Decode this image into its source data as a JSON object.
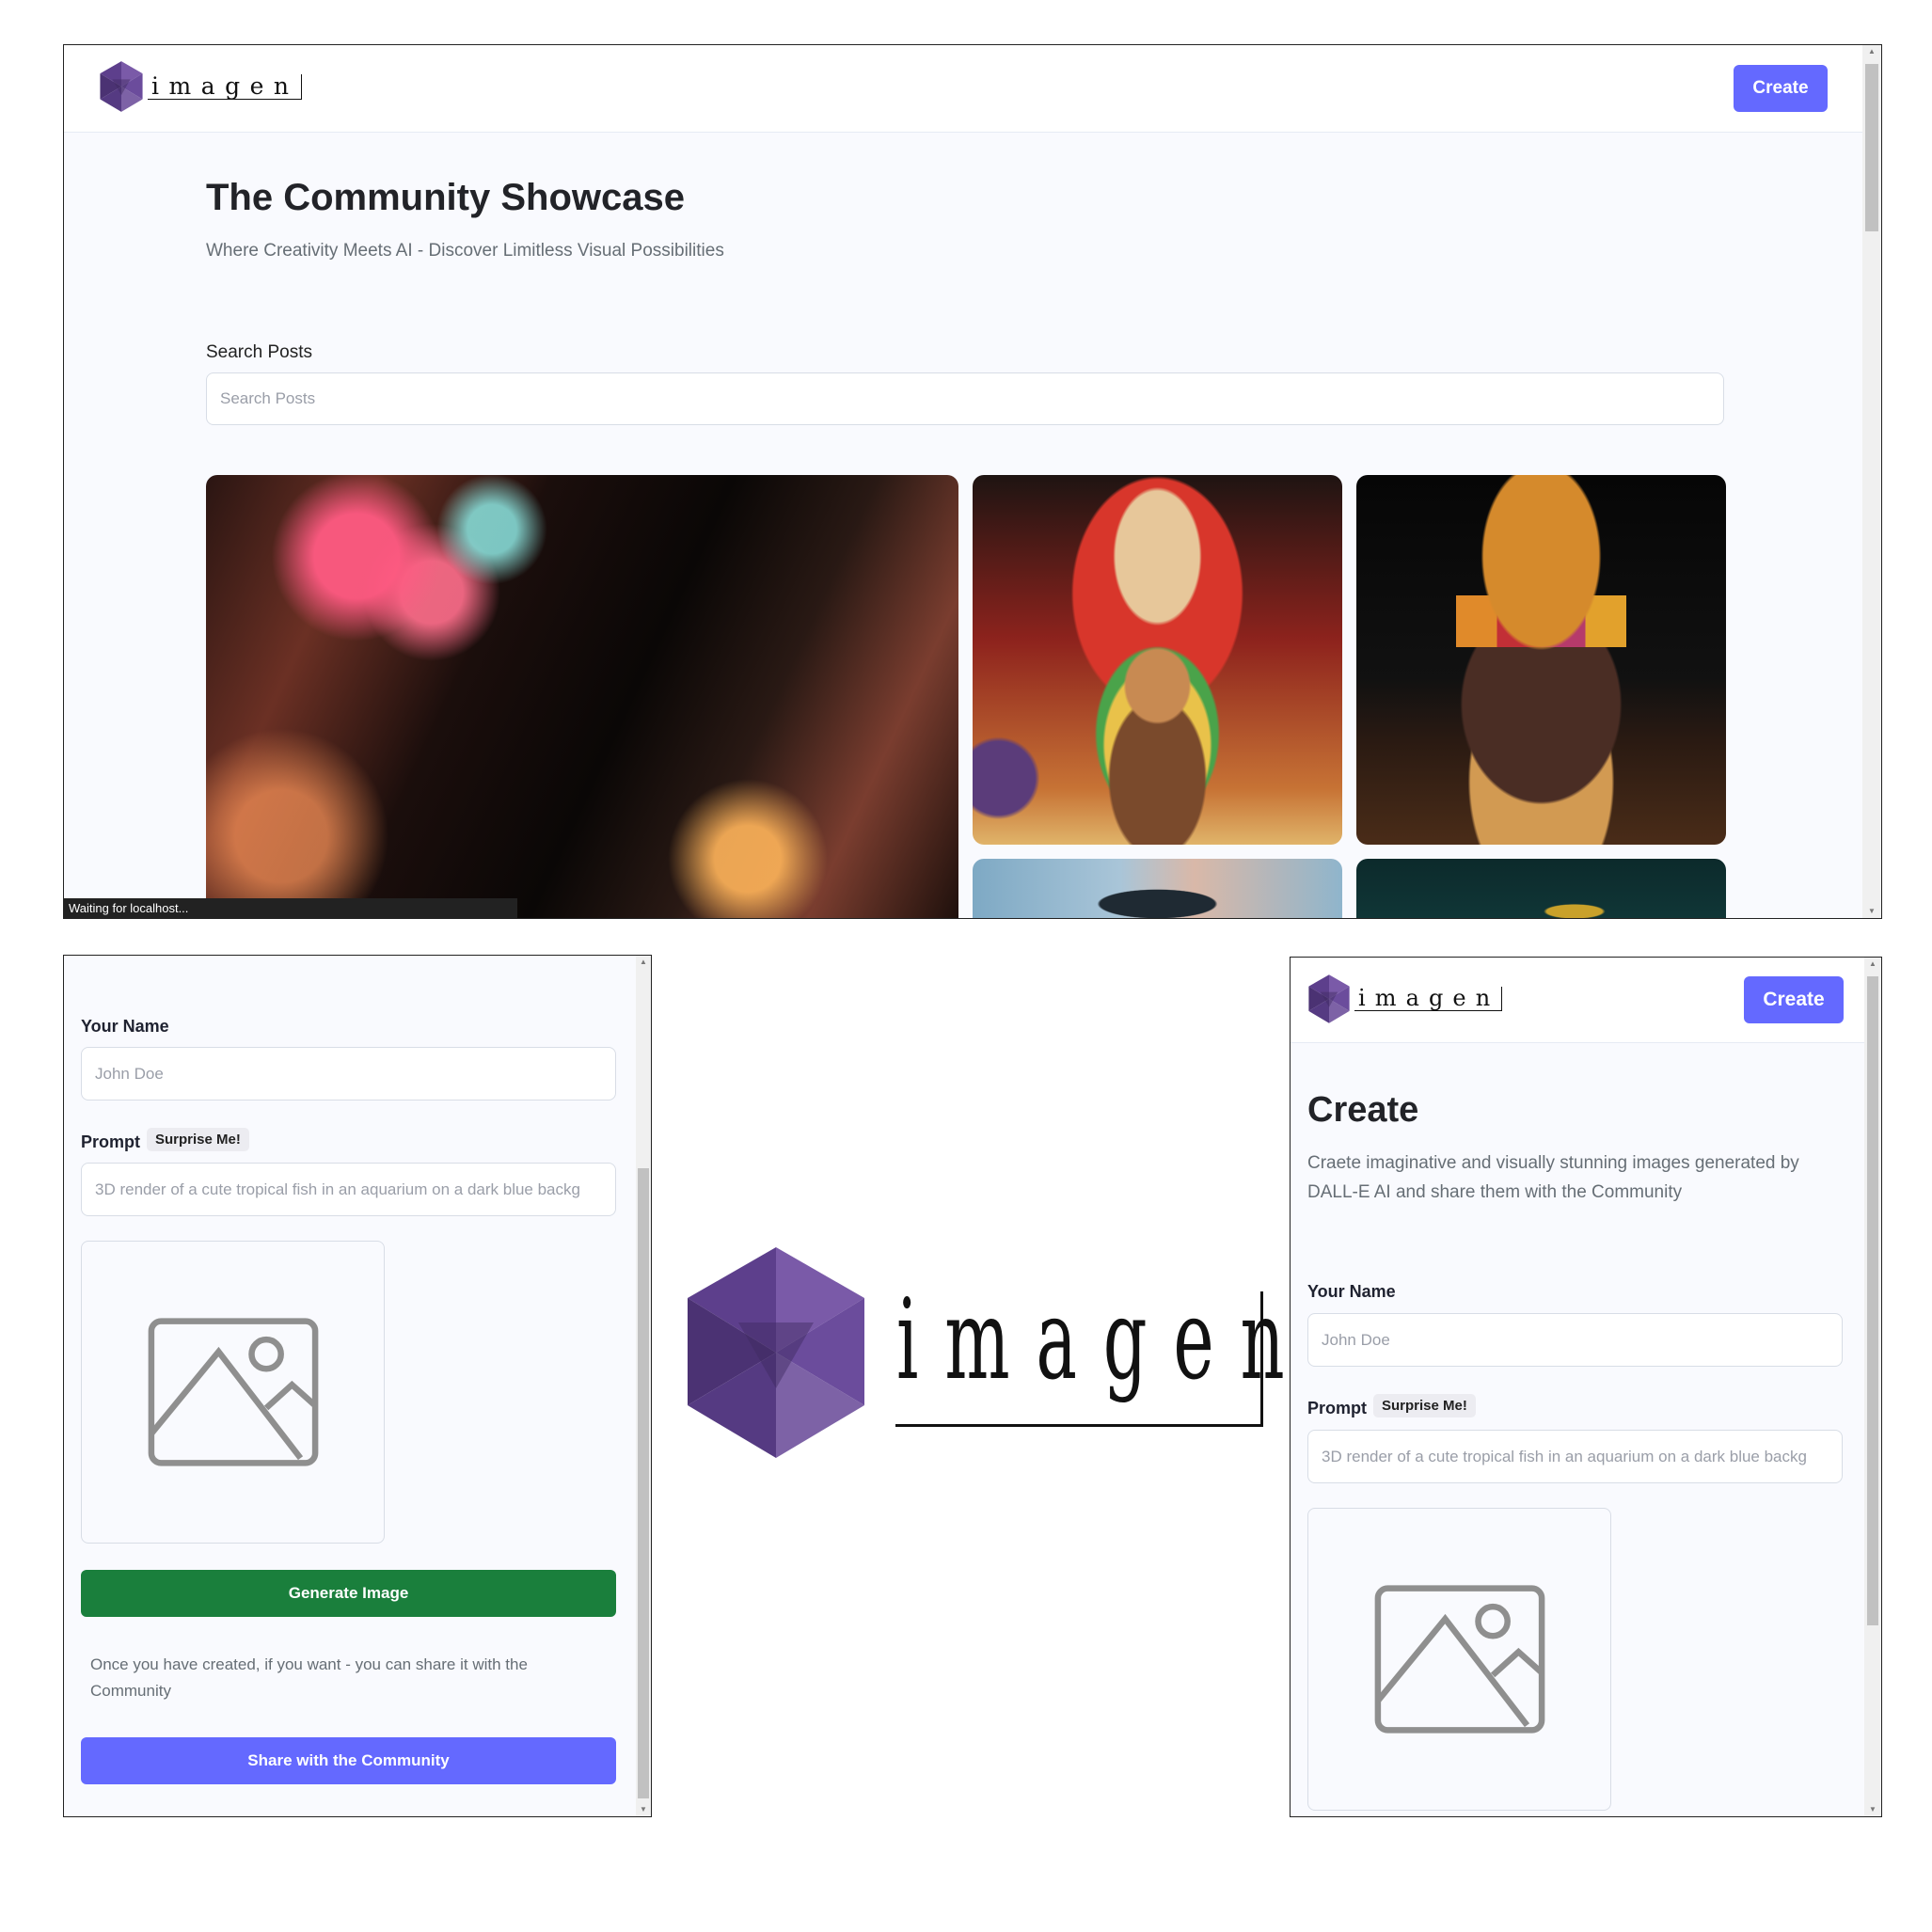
{
  "brand": {
    "logo_text": "imagen"
  },
  "home": {
    "create_button": "Create",
    "title": "The Community Showcase",
    "subtitle": "Where Creativity Meets AI - Discover Limitless Visual Possibilities",
    "search": {
      "label": "Search Posts",
      "placeholder": "Search Posts"
    },
    "status_bar": "Waiting for localhost..."
  },
  "create_form": {
    "name": {
      "label": "Your Name",
      "placeholder": "John Doe"
    },
    "prompt": {
      "label": "Prompt",
      "surprise_label": "Surprise Me!",
      "placeholder": "3D render of a cute tropical fish in an aquarium on a dark blue backg"
    },
    "generate_button": "Generate Image",
    "share_text": "Once you have created, if you want - you can share it with the Community",
    "share_button": "Share with the Community"
  },
  "create_page": {
    "create_button": "Create",
    "title": "Create",
    "subtitle": "Craete imaginative and visually stunning images generated by DALL-E AI and share them with the Community",
    "name": {
      "label": "Your Name",
      "placeholder": "John Doe"
    },
    "prompt": {
      "label": "Prompt",
      "surprise_label": "Surprise Me!",
      "placeholder": "3D render of a cute tropical fish in an aquarium on a dark blue backg"
    }
  },
  "colors": {
    "accent": "#6469ff",
    "generate_green": "#1a7f3c",
    "logo_purple": "#5b3d8a",
    "page_bg": "#f9fafe"
  },
  "icons": [
    "image-placeholder-icon",
    "scroll-up-arrow-icon",
    "scroll-down-arrow-icon"
  ]
}
